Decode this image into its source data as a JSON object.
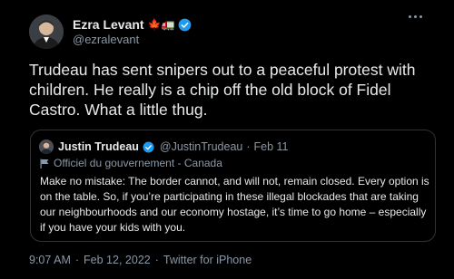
{
  "author": {
    "name": "Ezra Levant",
    "handle": "@ezralevant",
    "name_emojis": "🍁🚛"
  },
  "tweet": {
    "text": "Trudeau has sent snipers out to a peaceful protest with children. He really is a chip off the old block of Fidel Castro. What a little thug."
  },
  "quoted_tweet": {
    "name": "Justin Trudeau",
    "handle": "@JustinTrudeau",
    "separator": "·",
    "date": "Feb 11",
    "gov_label": "Officiel du gouvernement - Canada",
    "text": "Make no mistake: The border cannot, and will not, remain closed. Every option is on the table. So, if you’re participating in these illegal blockades that are taking our neighbourhoods and our economy hostage, it’s time to go home – especially if you have your kids with you."
  },
  "meta": {
    "time": "9:07 AM",
    "separator_1": "·",
    "date": "Feb 12, 2022",
    "separator_2": "·",
    "source": "Twitter for iPhone"
  },
  "colors": {
    "background": "#000000",
    "text": "#e7e9ea",
    "secondary": "#8b98a5",
    "verified": "#1d9bf0",
    "border": "#2f3336"
  },
  "icons": {
    "verified": "verified-badge-icon",
    "more": "more-horizontal-icon",
    "gov_flag": "flag-icon"
  }
}
